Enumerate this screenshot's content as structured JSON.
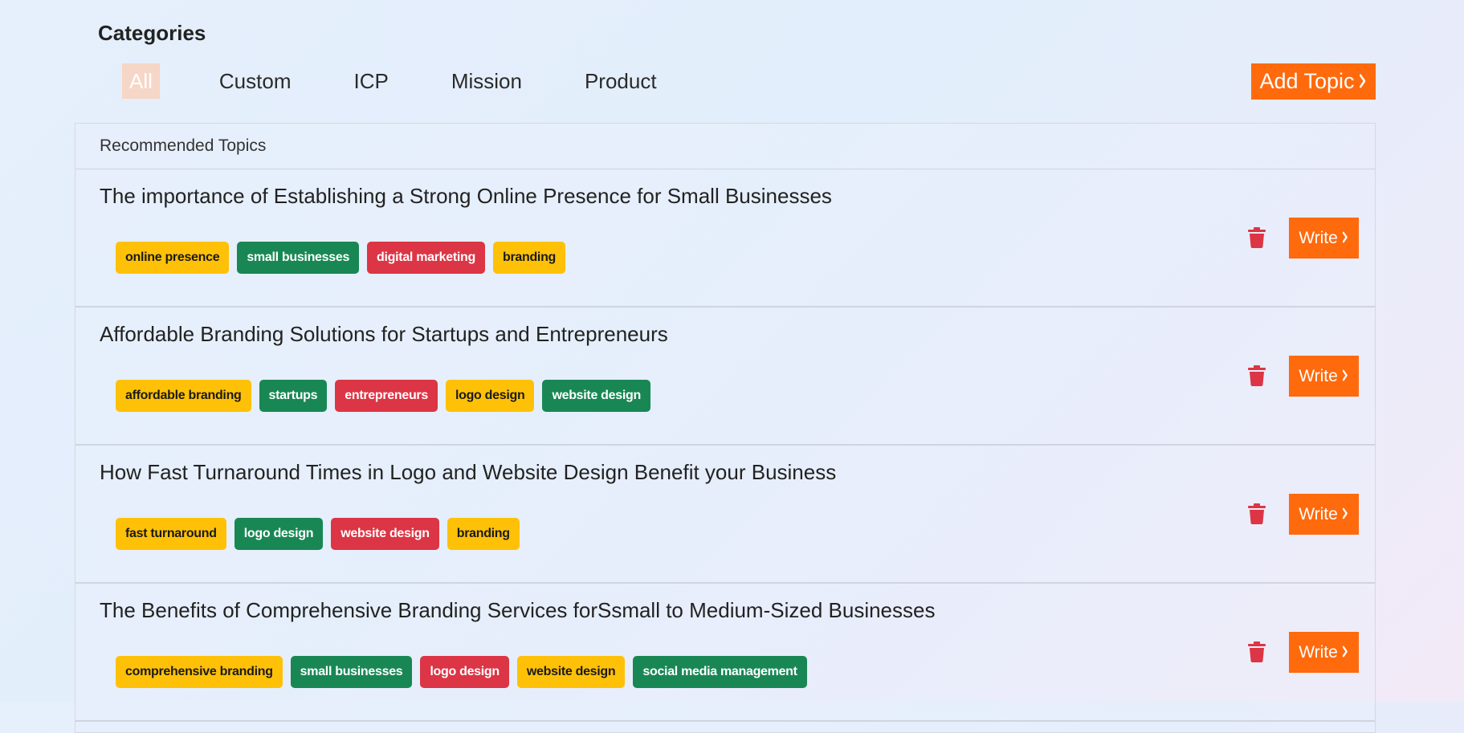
{
  "header": {
    "title": "Categories",
    "tabs": [
      {
        "label": "All",
        "active": true
      },
      {
        "label": "Custom",
        "active": false
      },
      {
        "label": "ICP",
        "active": false
      },
      {
        "label": "Mission",
        "active": false
      },
      {
        "label": "Product",
        "active": false
      }
    ],
    "add_topic_label": "Add Topic"
  },
  "panel": {
    "heading": "Recommended Topics",
    "write_label": "Write",
    "topics": [
      {
        "title": "The importance of Establishing a Strong Online Presence for Small Businesses",
        "tags": [
          {
            "label": "online presence",
            "color": "yellow"
          },
          {
            "label": "small businesses",
            "color": "green"
          },
          {
            "label": "digital marketing",
            "color": "red"
          },
          {
            "label": "branding",
            "color": "yellow"
          }
        ]
      },
      {
        "title": "Affordable Branding Solutions for Startups and Entrepreneurs",
        "tags": [
          {
            "label": "affordable branding",
            "color": "yellow"
          },
          {
            "label": "startups",
            "color": "green"
          },
          {
            "label": "entrepreneurs",
            "color": "red"
          },
          {
            "label": "logo design",
            "color": "yellow"
          },
          {
            "label": "website design",
            "color": "green"
          }
        ]
      },
      {
        "title": "How Fast Turnaround Times in Logo and Website Design Benefit your Business",
        "tags": [
          {
            "label": "fast turnaround",
            "color": "yellow"
          },
          {
            "label": "logo design",
            "color": "green"
          },
          {
            "label": "website design",
            "color": "red"
          },
          {
            "label": "branding",
            "color": "yellow"
          }
        ]
      },
      {
        "title": "The Benefits of Comprehensive Branding Services forSsmall to Medium-Sized Businesses",
        "tags": [
          {
            "label": "comprehensive branding",
            "color": "yellow"
          },
          {
            "label": "small businesses",
            "color": "green"
          },
          {
            "label": "logo design",
            "color": "red"
          },
          {
            "label": "website design",
            "color": "yellow"
          },
          {
            "label": "social media management",
            "color": "green"
          }
        ]
      }
    ]
  },
  "icons": {
    "delete": "trash-icon",
    "chevron": "chevron-right-icon"
  },
  "colors": {
    "accent": "#ff6a0d",
    "active_tab_bg": "#f6d6c6",
    "tag_yellow": "#ffc107",
    "tag_green": "#198754",
    "tag_red": "#dc3545",
    "delete_icon": "#dc3545"
  }
}
